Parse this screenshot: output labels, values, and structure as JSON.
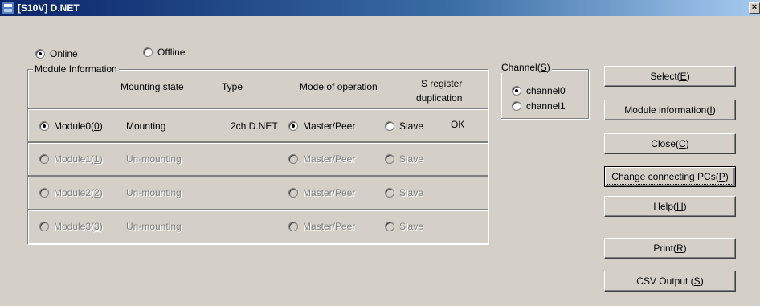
{
  "window": {
    "title": "[S10V] D.NET",
    "close_glyph": "×"
  },
  "connection": {
    "online_label": "Online",
    "offline_label": "Offline",
    "selected": "online"
  },
  "module_info": {
    "legend": "Module Information",
    "headers": {
      "mounting_state": "Mounting state",
      "type": "Type",
      "mode": "Mode of operation",
      "sreg": "S register",
      "sreg2": "duplication"
    },
    "rows": [
      {
        "label": "Module0(",
        "key": "0",
        "close": ")",
        "state": "Mounting",
        "type": "2ch D.NET",
        "master": "Master/Peer",
        "slave": "Slave",
        "sreg": "OK",
        "enabled": true
      },
      {
        "label": "Module1(",
        "key": "1",
        "close": ")",
        "state": "Un-mounting",
        "type": "",
        "master": "Master/Peer",
        "slave": "Slave",
        "sreg": "",
        "enabled": false
      },
      {
        "label": "Module2(",
        "key": "2",
        "close": ")",
        "state": "Un-mounting",
        "type": "",
        "master": "Master/Peer",
        "slave": "Slave",
        "sreg": "",
        "enabled": false
      },
      {
        "label": "Module3(",
        "key": "3",
        "close": ")",
        "state": "Un-mounting",
        "type": "",
        "master": "Master/Peer",
        "slave": "Slave",
        "sreg": "",
        "enabled": false
      }
    ]
  },
  "channel": {
    "legend_pre": "Channel(",
    "legend_key": "S",
    "legend_post": ")",
    "ch0": "channel0",
    "ch1": "channel1",
    "selected": "channel0"
  },
  "buttons": {
    "select": {
      "pre": "Select(",
      "key": "E",
      "post": ")"
    },
    "module_info": {
      "pre": "Module information(",
      "key": "I",
      "post": ")"
    },
    "close": {
      "pre": "Close(",
      "key": "C",
      "post": ")"
    },
    "change_pcs": {
      "pre": "Change connecting PCs(",
      "key": "P",
      "post": ")"
    },
    "help": {
      "pre": "Help(",
      "key": "H",
      "post": ")"
    },
    "print": {
      "pre": "Print(",
      "key": "R",
      "post": ")"
    },
    "csv": {
      "pre": "CSV Output (",
      "key": "S",
      "post": ")"
    }
  }
}
